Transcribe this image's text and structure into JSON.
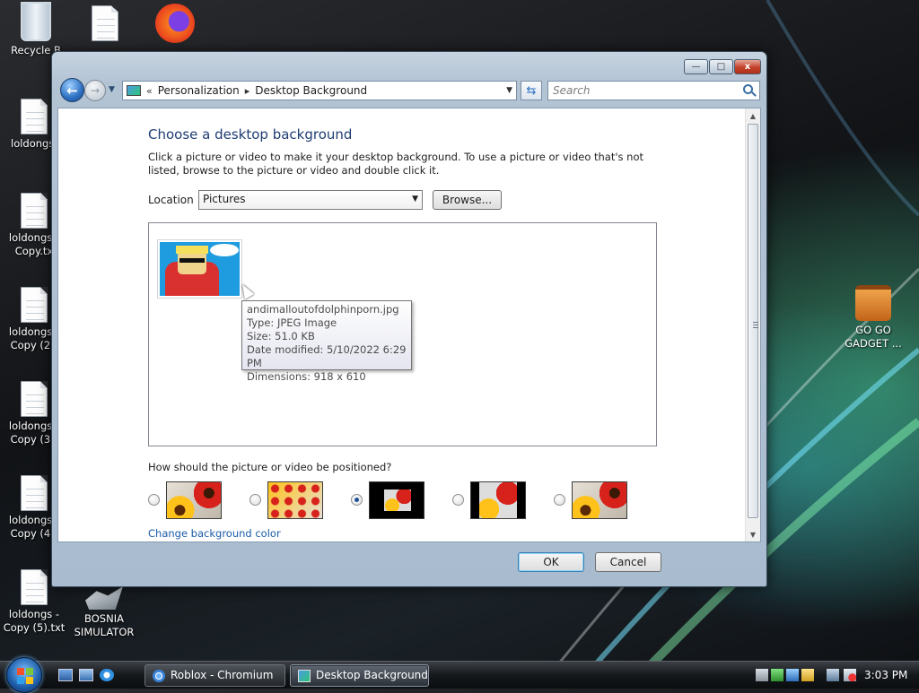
{
  "desktop": {
    "icons": [
      {
        "label": "Recycle B"
      },
      {
        "label": "loldongs."
      },
      {
        "label": "loldongs - Copy.tx"
      },
      {
        "label": "loldongs - Copy (2)."
      },
      {
        "label": "loldongs - Copy (3)."
      },
      {
        "label": "loldongs - Copy (4)."
      },
      {
        "label": "loldongs - Copy (5).txt"
      },
      {
        "label": "BOSNIA SIMULATOR"
      },
      {
        "label": "GO GO GADGET ..."
      }
    ]
  },
  "window": {
    "breadcrumb": {
      "chevron": "«",
      "items": [
        "Personalization",
        "Desktop Background"
      ],
      "separator": "▸"
    },
    "search": {
      "placeholder": "Search"
    },
    "controls": {
      "minimize": "—",
      "maximize": "□",
      "close": "x"
    },
    "title": "Choose a desktop background",
    "description": "Click a picture or video to make it your desktop background. To use a picture or video that's not listed, browse to the picture or video and double click it.",
    "location": {
      "label": "Location",
      "value": "Pictures"
    },
    "browse_label": "Browse...",
    "tooltip": {
      "name": "andimalloutofdolphinporn.jpg",
      "type": "Type: JPEG Image",
      "size": "Size: 51.0 KB",
      "modified": "Date modified: 5/10/2022 6:29 PM",
      "dimensions": "Dimensions: 918 x 610"
    },
    "position": {
      "question": "How should the picture or video be positioned?",
      "options": [
        "fill",
        "tile",
        "center",
        "fit",
        "stretch"
      ],
      "selected": "center"
    },
    "change_color_link": "Change background color",
    "ok_label": "OK",
    "cancel_label": "Cancel"
  },
  "taskbar": {
    "tasks": [
      {
        "label": "Roblox - Chromium",
        "active": false
      },
      {
        "label": "Desktop Background",
        "active": true
      }
    ],
    "clock": "3:03 PM"
  },
  "colors": {
    "accent": "#1e3d73",
    "link": "#1a5ca8",
    "close": "#c2422b"
  }
}
